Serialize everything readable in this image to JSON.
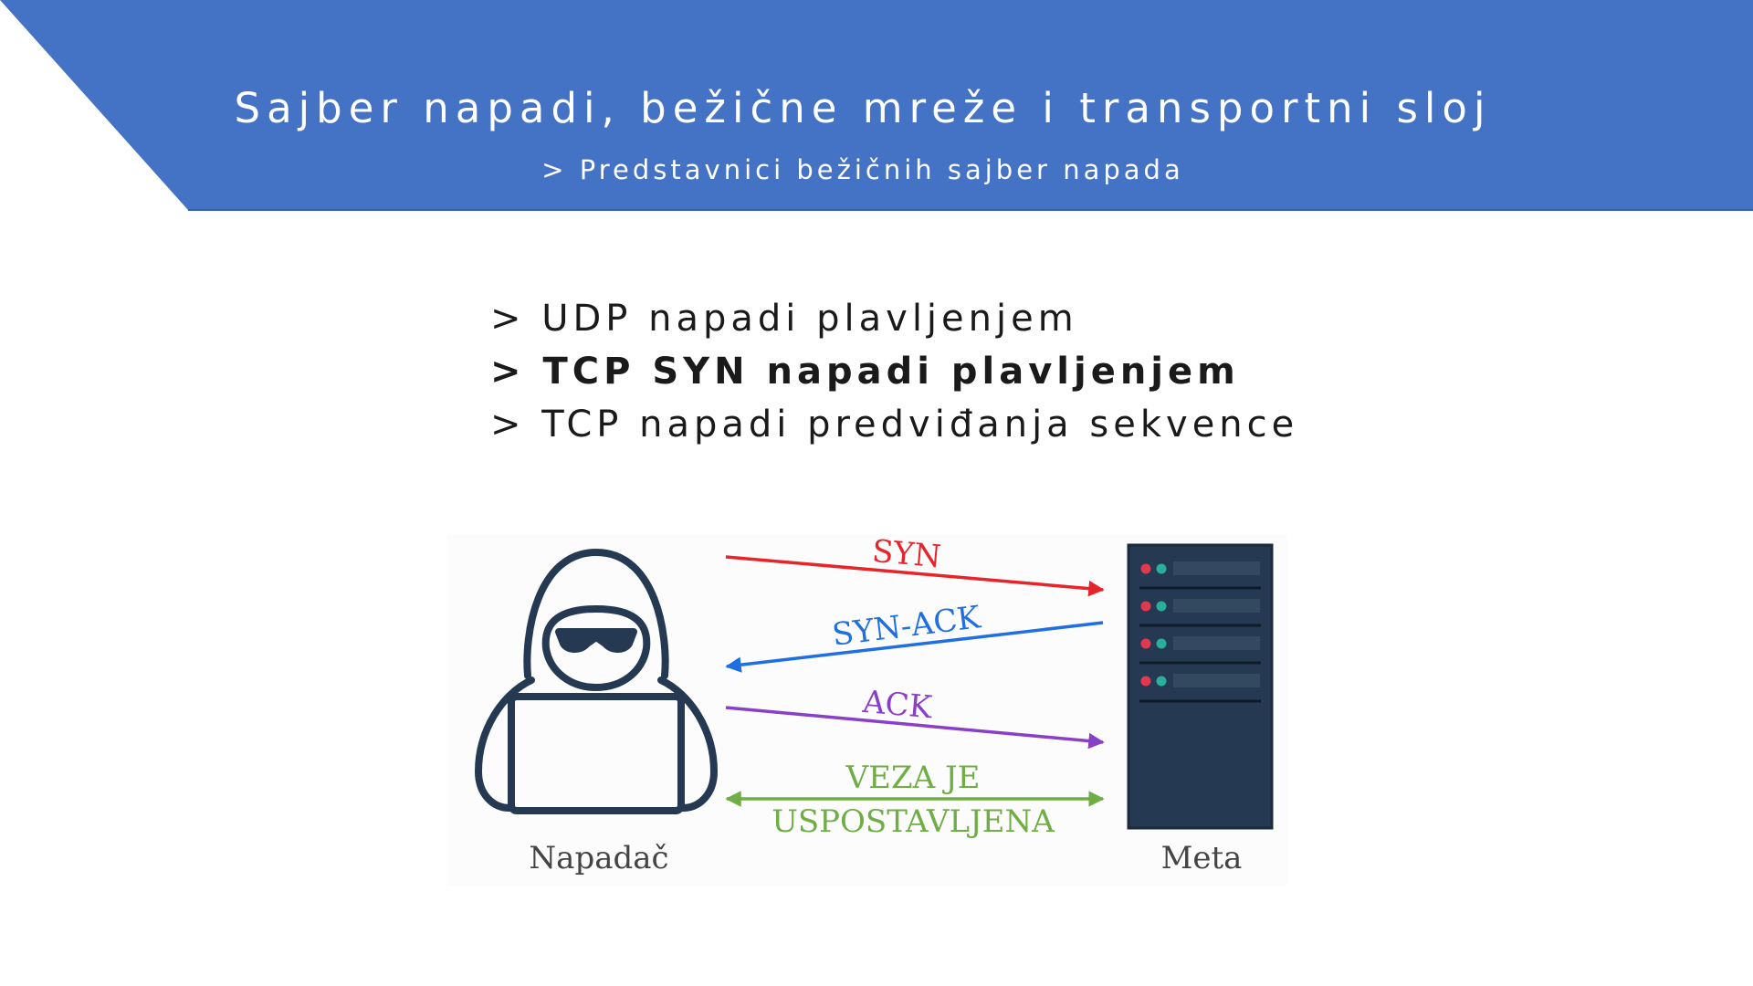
{
  "header": {
    "title": "Sajber napadi, bežične mreže i transportni sloj",
    "subtitle": "> Predstavnici bežičnih sajber napada",
    "banner_color": "#4472c4"
  },
  "bullets": [
    {
      "text": "> UDP napadi plavljenjem",
      "bold": false
    },
    {
      "text": "> TCP SYN napadi plavljenjem",
      "bold": true
    },
    {
      "text": "> TCP napadi predviđanja sekvence",
      "bold": false
    }
  ],
  "diagram": {
    "attacker_label": "Napadač",
    "target_label": "Meta",
    "attacker_icon": "hooded-hacker-icon",
    "target_icon": "server-rack-icon",
    "messages": [
      {
        "label": "SYN",
        "color": "#e8242b",
        "direction": "attacker-to-target"
      },
      {
        "label": "SYN-ACK",
        "color": "#1f6fe0",
        "direction": "target-to-attacker"
      },
      {
        "label": "ACK",
        "color": "#8a3fc8",
        "direction": "attacker-to-target"
      },
      {
        "label_line1": "VEZA JE",
        "label_line2": "USPOSTAVLJENA",
        "color": "#6fad45",
        "direction": "both"
      }
    ],
    "icon_color": "#253a52",
    "led_red": "#e0384f",
    "led_green": "#2ab09a"
  }
}
